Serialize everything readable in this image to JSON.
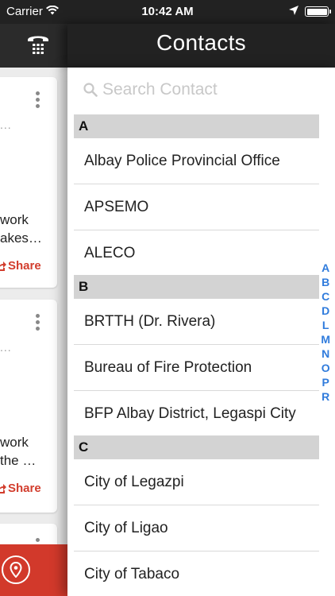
{
  "status_bar": {
    "carrier": "Carrier",
    "time": "10:42 AM",
    "icons": [
      "wifi-icon",
      "location-arrow-icon",
      "battery-icon"
    ]
  },
  "left_panel": {
    "header_icon": "phone-keypad-icon",
    "cards": [
      {
        "dots": "...",
        "snippet_lines": [
          "work",
          "akes…"
        ],
        "share_label": "Share"
      },
      {
        "dots": "...",
        "snippet_lines": [
          "work",
          "the …"
        ],
        "share_label": "Share"
      }
    ],
    "footer_icon": "map-pin-icon",
    "footer_color": "#d2392b"
  },
  "contacts": {
    "title": "Contacts",
    "search_placeholder": "Search Contact",
    "sections": [
      {
        "letter": "A",
        "items": [
          "Albay Police Provincial Office",
          "APSEMO",
          "ALECO"
        ]
      },
      {
        "letter": "B",
        "items": [
          "BRTTH (Dr. Rivera)",
          "Bureau of Fire Protection",
          "BFP Albay District, Legaspi City"
        ]
      },
      {
        "letter": "C",
        "items": [
          "City of Legazpi",
          "City of Ligao",
          "City of Tabaco"
        ]
      }
    ],
    "index_letters": [
      "A",
      "B",
      "C",
      "D",
      "L",
      "M",
      "N",
      "O",
      "P",
      "R"
    ],
    "accent_color": "#2f7bdc"
  }
}
